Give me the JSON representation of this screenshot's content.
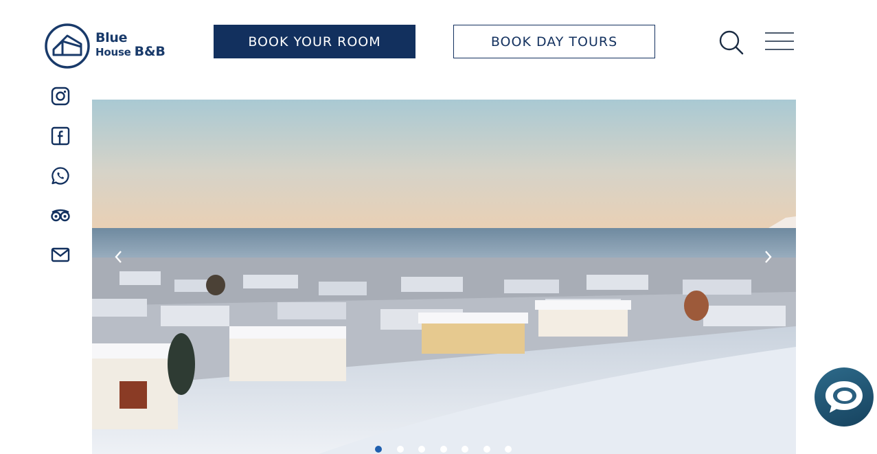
{
  "header": {
    "logo": {
      "line1": "Blue",
      "line2_small": "House ",
      "line2_large": "B&B"
    },
    "book_room_label": "BOOK YOUR ROOM",
    "book_tours_label": "BOOK DAY TOURS"
  },
  "icons": {
    "search": "search-icon",
    "menu": "hamburger-menu-icon",
    "social": [
      "instagram-icon",
      "facebook-icon",
      "whatsapp-icon",
      "tripadvisor-icon",
      "mail-icon"
    ],
    "chat": "chat-bubble-icon"
  },
  "slider": {
    "slide_count": 7,
    "active_index": 0,
    "image": "Aerial view of snow-covered town houses by the sea at sunrise"
  },
  "colors": {
    "brand_navy": "#12305e",
    "logo_blue": "#193a6a",
    "dot_active": "#1f5fae",
    "chat_teal": "#1f5577"
  }
}
